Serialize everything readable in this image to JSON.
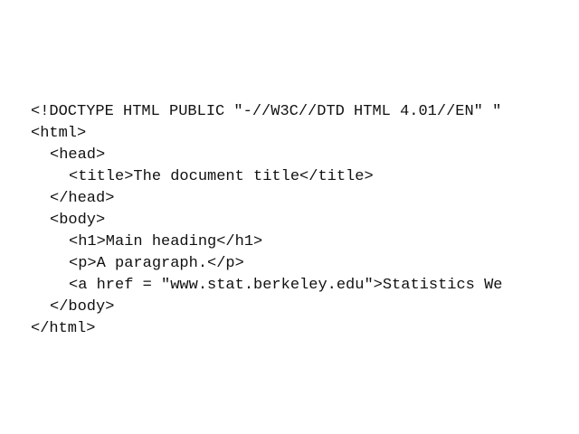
{
  "code": {
    "lines": [
      "<!DOCTYPE HTML PUBLIC \"-//W3C//DTD HTML 4.01//EN\" \"",
      "<html>",
      "<head>",
      "<title>The document title</title>",
      "</head>",
      "<body>",
      "<h1>Main heading</h1>",
      "<p>A paragraph.</p>",
      "<a href = \"www.stat.berkeley.edu\">Statistics We",
      "</body>",
      "</html>"
    ]
  }
}
